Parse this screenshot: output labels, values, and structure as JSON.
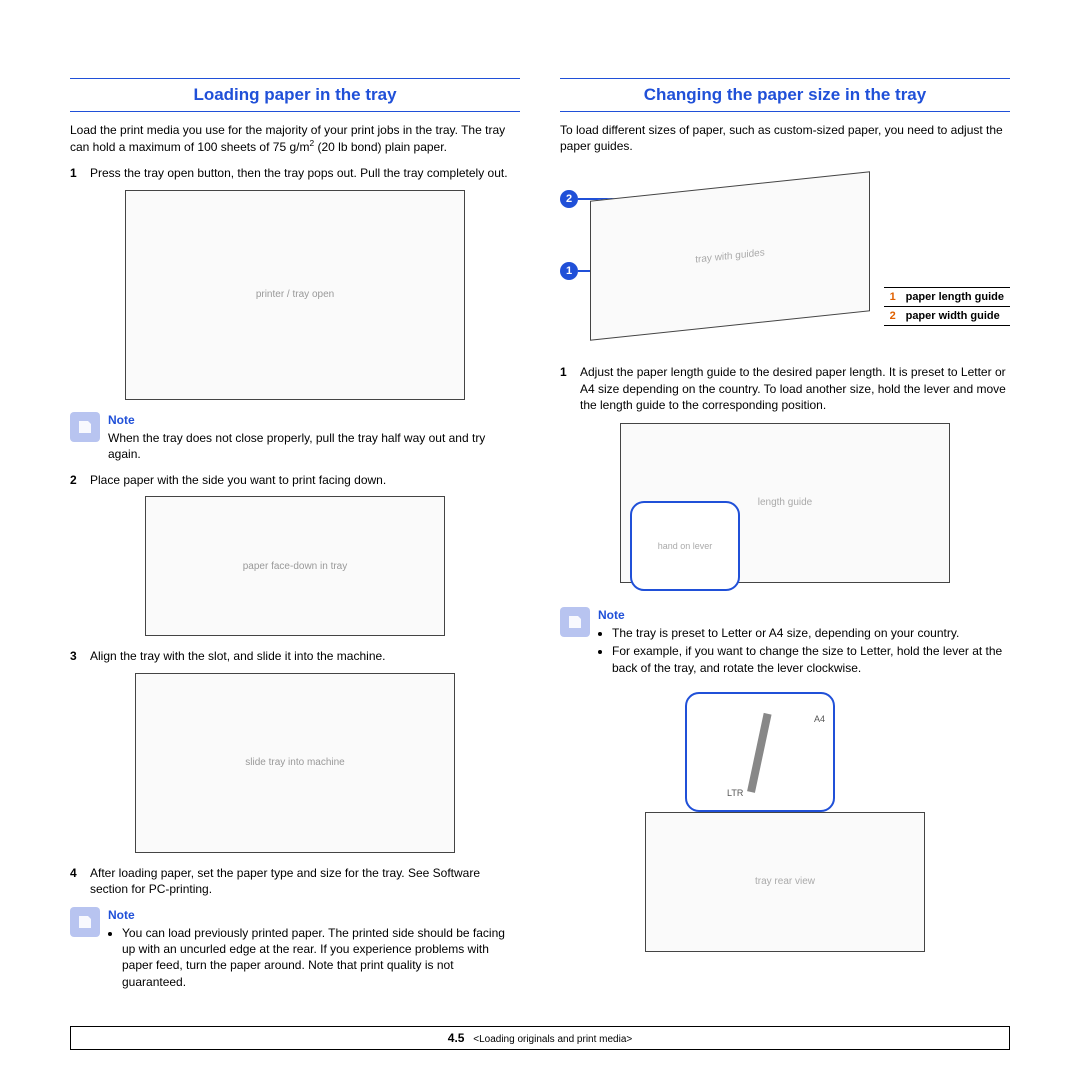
{
  "left": {
    "title": "Loading paper in the tray",
    "intro_pre": "Load the print media you use for the majority of your print jobs in the tray. The tray can hold a maximum of 100 sheets of 75 g/m",
    "intro_sup": "2",
    "intro_post": " (20 lb bond) plain paper.",
    "step1": "Press the tray open button, then the tray pops out. Pull the tray completely out.",
    "note1_label": "Note",
    "note1_text": "When the tray does not close properly, pull the tray half way out and try again.",
    "step2": "Place paper with the side you want to print facing down.",
    "step3": "Align the tray with the slot, and slide it into the machine.",
    "step4": "After loading paper, set the paper type and size for the tray. See Software section for PC-printing.",
    "note2_label": "Note",
    "note2_bullet": "You can load previously printed paper. The printed side should be facing up with an uncurled edge at the rear. If you experience problems with paper feed, turn the paper around. Note that print quality is not guaranteed."
  },
  "right": {
    "title": "Changing the paper size in the tray",
    "intro": "To load different sizes of paper, such as custom-sized paper, you need to adjust the paper guides.",
    "callout1": "1",
    "callout2": "2",
    "legend1_num": "1",
    "legend1_label": "paper length guide",
    "legend2_num": "2",
    "legend2_label": "paper width guide",
    "step1": "Adjust the paper length guide to the desired paper length. It is preset to Letter or A4 size depending on the country. To load another size, hold the lever and move the length guide to the corresponding position.",
    "note_label": "Note",
    "note_b1": "The tray is preset to Letter or A4 size, depending on your country.",
    "note_b2": "For example, if you want to change the size to Letter, hold the lever at the back of the tray, and rotate the lever clockwise.",
    "lever_a4": "A4",
    "lever_ltr": "LTR"
  },
  "footer": {
    "page": "4.5",
    "chapter": "<Loading originals and print media>"
  }
}
